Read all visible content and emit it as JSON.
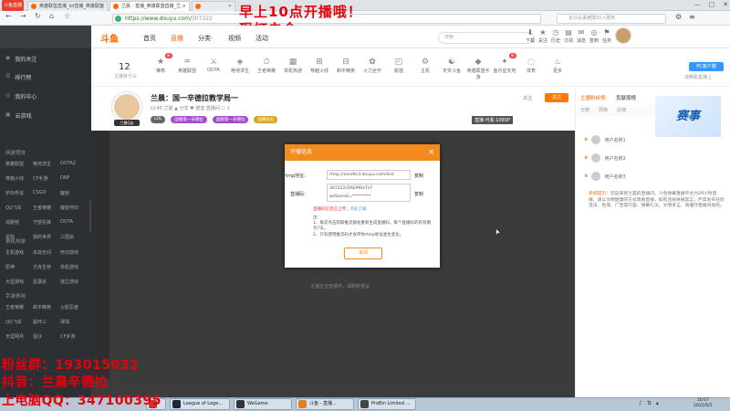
{
  "browser": {
    "brand": "斗鱼直播",
    "tabs": [
      {
        "title": "英雄联盟直播_lol直播_英雄联盟",
        "active": false
      },
      {
        "title": "兰晨 - 直播_英雄联盟直播_兰...",
        "active": true
      },
      {
        "title": "",
        "active": false
      }
    ],
    "url_host": "https://www.douyu.com/",
    "url_path": "307322",
    "search_placeholder": "长沙夫妻被撞10人致死",
    "controls": {
      "back": "←",
      "forward": "→",
      "refresh": "↻",
      "home": "⌂",
      "star": "☆",
      "min": "—",
      "max": "□",
      "close": "✕"
    }
  },
  "overlay_top": {
    "line1": "早上10点开播哦！",
    "line2": "现打白金"
  },
  "site": {
    "logo": "斗鱼",
    "nav": [
      {
        "label": "首页",
        "active": false
      },
      {
        "label": "直播",
        "active": true
      },
      {
        "label": "分类·",
        "active": false
      },
      {
        "label": "视频",
        "active": false
      },
      {
        "label": "活动",
        "active": false
      }
    ],
    "search_placeholder": "搜索",
    "header_icons": [
      {
        "glyph": "⬇",
        "label": "下载"
      },
      {
        "glyph": "★",
        "label": "关注"
      },
      {
        "glyph": "◷",
        "label": "历史"
      },
      {
        "glyph": "▤",
        "label": "订阅"
      },
      {
        "glyph": "✉",
        "label": "消息"
      },
      {
        "glyph": "◎",
        "label": "签到"
      },
      {
        "glyph": "⚑",
        "label": "任务"
      }
    ]
  },
  "sidebar": {
    "items": [
      {
        "glyph": "◉",
        "label": "我的关注"
      },
      {
        "glyph": "☰",
        "label": "排行榜"
      },
      {
        "glyph": "◎",
        "label": "我的中心"
      },
      {
        "glyph": "▣",
        "label": "云游戏"
      }
    ],
    "sections": [
      {
        "title": "网游竞技",
        "items": [
          "英雄联盟",
          "绝地求生",
          "DOTA2",
          "穿越火线",
          "CF手游",
          "DNF",
          "炉石传说",
          "CSGO",
          "魔兽",
          "QQ飞车",
          "王者荣耀",
          "魔兽怀旧",
          "逃跑吧",
          "守望先锋",
          "DOTA",
          "星际",
          "我的世界",
          "三国杀"
        ]
      },
      {
        "title": "单机热游",
        "items": [
          "主机游戏",
          "永劫无间",
          "怀旧游戏",
          "原神",
          "方舟生存",
          "单机游戏",
          "大型游戏",
          "星露谷",
          "独立游戏"
        ]
      },
      {
        "title": "手游休闲",
        "items": [
          "王者荣耀",
          "和平精英",
          "火影忍者",
          "QQ飞车",
          "崩坏三",
          "球球",
          "天涯明月",
          "蛋仔",
          "CF手游"
        ]
      }
    ]
  },
  "categories": {
    "count": "12",
    "count_label": "主播有什么",
    "items": [
      {
        "glyph": "★",
        "label": "推荐",
        "badge": "新"
      },
      {
        "glyph": "♒",
        "label": "英雄联盟"
      },
      {
        "glyph": "⚔",
        "label": "DOTA"
      },
      {
        "glyph": "◈",
        "label": "绝地求生"
      },
      {
        "glyph": "⏱",
        "label": "王者荣耀"
      },
      {
        "glyph": "▦",
        "label": "单机热游"
      },
      {
        "glyph": "⊞",
        "label": "穿越火线"
      },
      {
        "glyph": "⊟",
        "label": "和平精英"
      },
      {
        "glyph": "✿",
        "label": "火力全开"
      },
      {
        "glyph": "◰",
        "label": "颜值"
      },
      {
        "glyph": "⚙",
        "label": "主机"
      },
      {
        "glyph": "☯",
        "label": "天天斗鱼"
      },
      {
        "glyph": "◆",
        "label": "英雄联盟手游"
      },
      {
        "glyph": "✦",
        "label": "鱼乐星天地",
        "badge": "新"
      },
      {
        "glyph": "◌",
        "label": "体育"
      },
      {
        "glyph": "♨",
        "label": "更多"
      }
    ],
    "pc_button": "PC客户端",
    "pc_sub": "流畅看直播上"
  },
  "room": {
    "avatar_label": "兰晨Q友",
    "title": "兰晨：国一辛德拉教学局一",
    "sub": "LV.45  兰晨   ▲ 分享  ♥ 赠送 直播间  ☐ 1",
    "tags": [
      {
        "text": "LOL",
        "color": "#666"
      },
      {
        "text": "国服第一辛德拉",
        "color": "#a34ec9"
      },
      {
        "text": "国服第一辛德拉",
        "color": "#a34ec9"
      },
      {
        "text": "国服钻石",
        "color": "#d9a520"
      }
    ],
    "follow_label": "关注",
    "follow_count": "关注",
    "rank_label": "直播·可看·1080P"
  },
  "player": {
    "hint": "主播正在直播中，请刷新重试"
  },
  "modal": {
    "title": "开播信息",
    "rtmp_label": "rtmp地址：",
    "rtmp_value": "rtmp://sendtc3.douyu.com/live",
    "code_label": "直播码：",
    "code_value": "307322rDAEMOsTn?wsSecret=*********",
    "code_value2": "",
    "copy_label": "复制",
    "warning": "直播码信息已上传，",
    "warning_link": "点此了解",
    "note_title": "注：",
    "note1": "1、每次点击获取推流都会重新生成直播码，每个直播码的有效期为7天。",
    "note2": "2、只有使用推流码才会带你rtmp地址发生变化。",
    "close_button": "关闭"
  },
  "right_panel": {
    "tabs": [
      {
        "label": "主播粉丝榜",
        "active": true
      },
      {
        "label": "贡献周榜",
        "active": false
      }
    ],
    "sub_tabs": [
      "日榜",
      "周榜",
      "总榜"
    ],
    "fans": [
      "用户名称1",
      "用户名称2",
      "用户名称3"
    ],
    "promo_text": "赛事",
    "welcome_label": "系统提示：",
    "welcome": "欢迎来到兰晨的直播间，斗鱼弹幕直播平台为24小时直播，请以文明健康的方式观看直播，如有违规将被禁言，严禁发布任何违法、色情、广告等内容，弹幕礼仪，文明发言，请遵守直播间规则。"
  },
  "overlay_bottom": {
    "line1": "粉丝群：193015032",
    "line2": "抖音：兰晨辛德拉",
    "line3": "上电脑QQ：347100395"
  },
  "taskbar": {
    "buttons": [
      {
        "label": "",
        "color": "#c0392b"
      },
      {
        "label": "League of Lege...",
        "color": "#1a2a3a"
      },
      {
        "label": "WeGame",
        "color": "#333"
      },
      {
        "label": "斗鱼 - 直播...",
        "color": "#e67e22"
      },
      {
        "label": "ProBin Limited ...",
        "color": "#444"
      }
    ],
    "time": "10:07",
    "date": "2022/5/5"
  }
}
